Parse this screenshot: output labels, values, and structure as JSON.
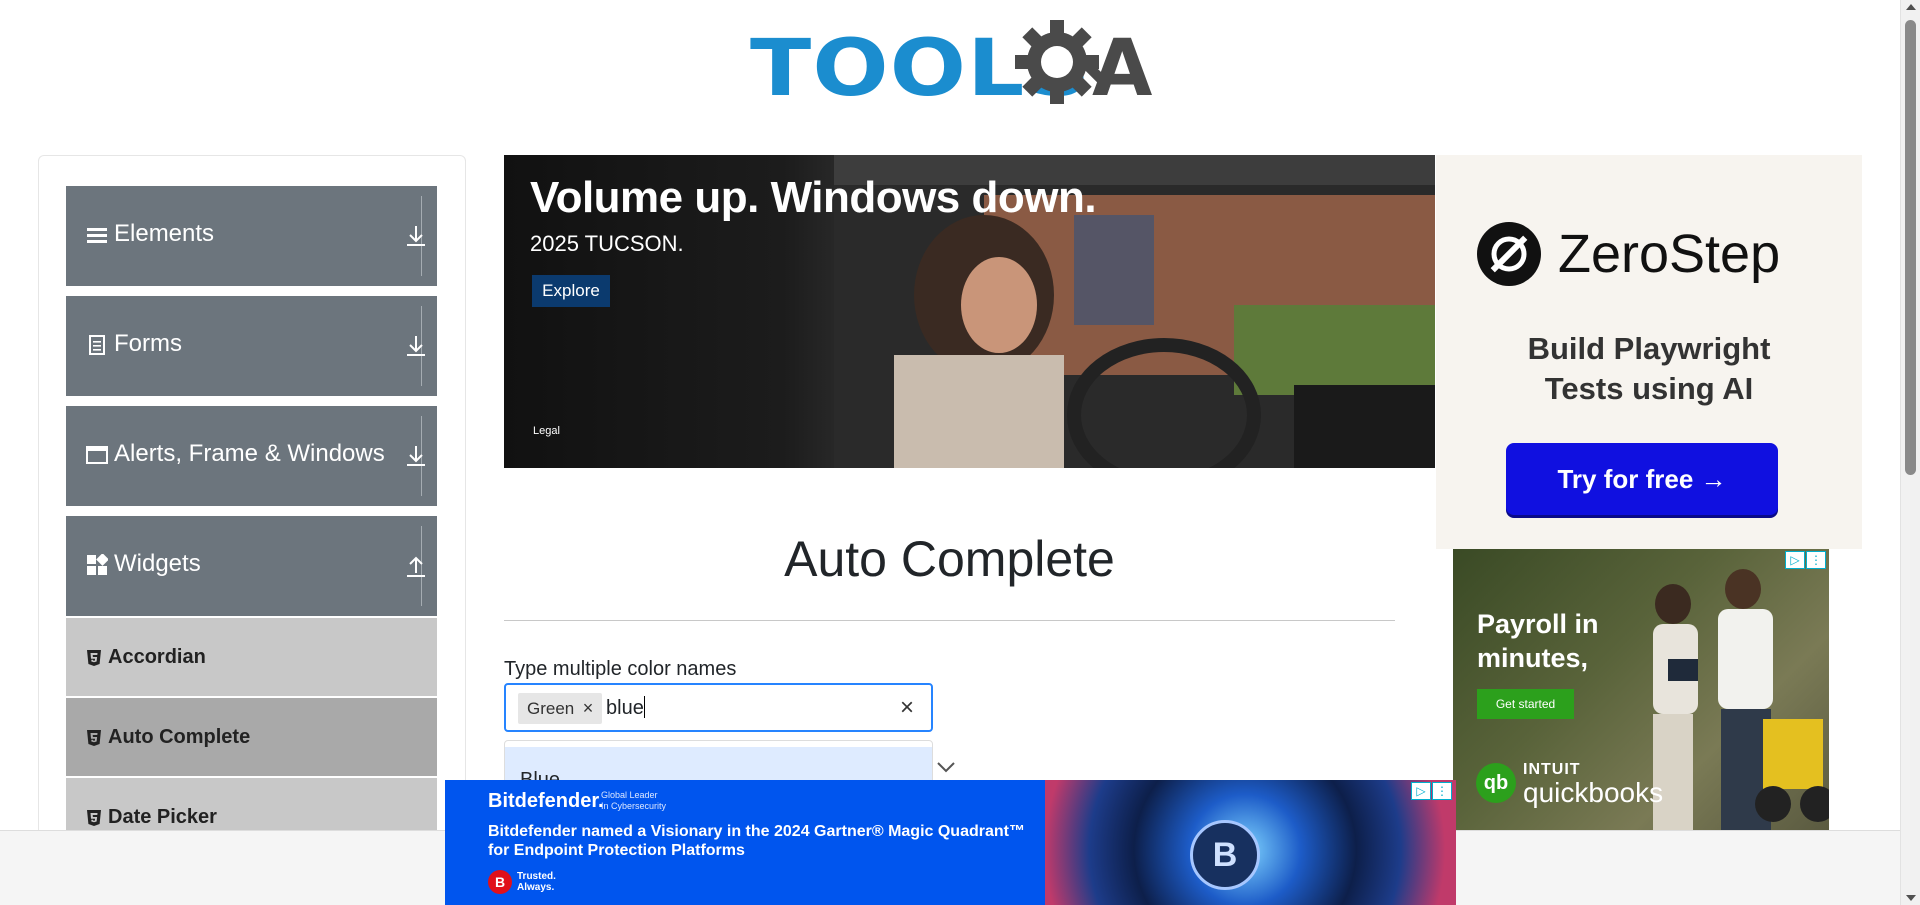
{
  "header": {
    "logo_text": "TOOLS",
    "logo_letter": "A"
  },
  "sidebar": {
    "groups": [
      {
        "label": "Elements",
        "icon": "hamburger-icon",
        "arrow": "download-arrow-icon"
      },
      {
        "label": "Forms",
        "icon": "document-icon",
        "arrow": "download-arrow-icon"
      },
      {
        "label": "Alerts, Frame & Windows",
        "icon": "window-icon",
        "arrow": "download-arrow-icon"
      },
      {
        "label": "Widgets",
        "icon": "widgets-icon",
        "arrow": "upload-arrow-icon"
      }
    ],
    "items": [
      {
        "label": "Accordian",
        "active": false
      },
      {
        "label": "Auto Complete",
        "active": true
      },
      {
        "label": "Date Picker",
        "active": false
      }
    ]
  },
  "banner_ad": {
    "title": "Volume up. Windows down.",
    "subtitle": "2025 TUCSON.",
    "cta": "Explore",
    "legal": "Legal"
  },
  "zerostep_ad": {
    "brand": "ZeroStep",
    "tagline_line1": "Build Playwright",
    "tagline_line2": "Tests using AI",
    "cta": "Try for free →"
  },
  "quickbooks_ad": {
    "headline_line1": "Payroll in",
    "headline_line2": "minutes,",
    "cta": "Get started",
    "brand_top": "INTUIT",
    "brand_bottom": "quickbooks",
    "logo": "qb"
  },
  "main": {
    "title": "Auto Complete",
    "field_label": "Type multiple color names",
    "chips": [
      {
        "label": "Green"
      }
    ],
    "input_value": "blue",
    "options": [
      "Blue"
    ]
  },
  "bitdefender_ad": {
    "brand": "Bitdefender.",
    "brand_sub_line1": "Global Leader",
    "brand_sub_line2": "In Cybersecurity",
    "headline": "Bitdefender named a Visionary in the 2024 Gartner® Magic Quadrant™ for Endpoint Protection Platforms",
    "badge": "B",
    "trust_line1": "Trusted.",
    "trust_line2": "Always.",
    "eye_letter": "B"
  },
  "colors": {
    "sidebar_group": "#6c757d",
    "sidebar_item": "#c8c8c8",
    "sidebar_item_active": "#a9a9a9",
    "input_focus": "#2684ff",
    "option_highlight": "#deebff",
    "logo_blue": "#1b8dcf"
  }
}
